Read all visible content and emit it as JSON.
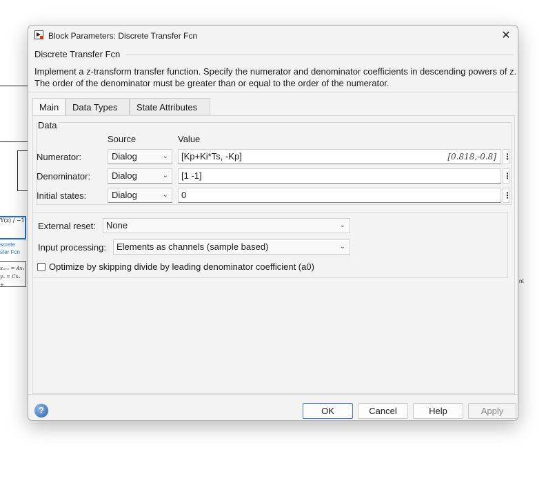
{
  "background": {
    "block_tf": "Y(z) / −1",
    "block_label_lines": [
      "screte",
      "sfer Fcn"
    ],
    "ss_lines": [
      "xₙ₊₁ = Axₙ",
      "yₙ = Cxₙ +"
    ],
    "cut_text": "nt"
  },
  "window": {
    "title": "Block Parameters: Discrete Transfer Fcn",
    "close_glyph": "✕"
  },
  "block": {
    "name": "Discrete Transfer Fcn",
    "description": "Implement a z-transform transfer function. Specify the numerator and denominator coefficients in descending powers of z. The order of the denominator must be greater than or equal to the order of the numerator."
  },
  "tabs": [
    {
      "label": "Main",
      "active": true
    },
    {
      "label": "Data Types",
      "active": false
    },
    {
      "label": "State Attributes",
      "active": false
    }
  ],
  "data_section": {
    "legend": "Data",
    "source_header": "Source",
    "value_header": "Value",
    "rows": [
      {
        "label": "Numerator:",
        "source": "Dialog",
        "value": "[Kp+Ki*Ts, -Kp]",
        "evaluated": "[0.818,-0.8]"
      },
      {
        "label": "Denominator:",
        "source": "Dialog",
        "value": "[1 -1]",
        "evaluated": ""
      },
      {
        "label": "Initial states:",
        "source": "Dialog",
        "value": "0",
        "evaluated": ""
      }
    ]
  },
  "options": {
    "external_reset_label": "External reset:",
    "external_reset_value": "None",
    "input_processing_label": "Input processing:",
    "input_processing_value": "Elements as channels (sample based)",
    "optimize_label": "Optimize by skipping divide by leading denominator coefficient (a0)",
    "optimize_checked": false
  },
  "buttons": {
    "ok": "OK",
    "cancel": "Cancel",
    "help": "Help",
    "apply": "Apply"
  },
  "icons": {
    "app": "simulink-block-icon",
    "help": "help-icon",
    "dropdown": "chevron-down-icon",
    "more": "vertical-ellipsis-icon"
  },
  "colors": {
    "accent": "#3b79c6",
    "block_highlight": "#1f6fd1"
  }
}
